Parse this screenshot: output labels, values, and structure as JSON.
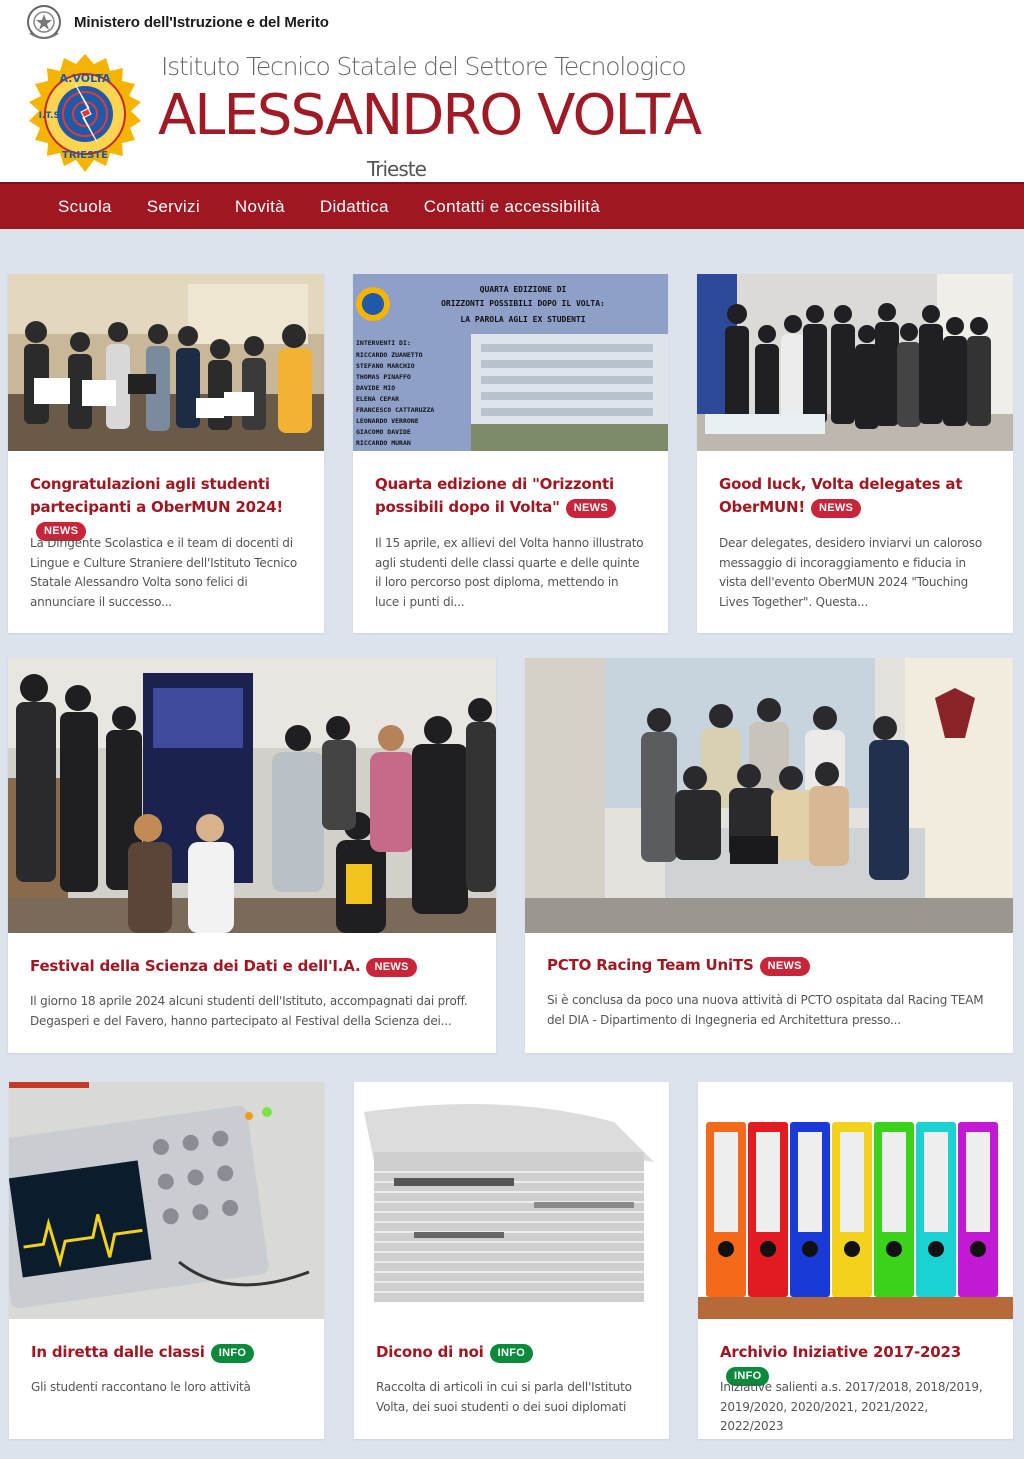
{
  "header": {
    "ministry": "Ministero dell'Istruzione e del Merito",
    "school_subtitle": "Istituto Tecnico Statale del Settore Tecnologico",
    "school_name": "ALESSANDRO VOLTA",
    "school_city": "Trieste"
  },
  "nav": {
    "items": [
      "Scuola",
      "Servizi",
      "Novità",
      "Didattica",
      "Contatti e accessibilità"
    ]
  },
  "cards": [
    {
      "title": "Congratulazioni agli studenti partecipanti a OberMUN 2024!",
      "badge": "NEWS",
      "text": "La Dirigente Scolastica e il team di docenti di Lingue e Culture Straniere dell'Istituto Tecnico Statale Alessandro Volta sono felici di annunciare il successo..."
    },
    {
      "title": "Quarta edizione di \"Orizzonti possibili dopo il Volta\"",
      "badge": "NEWS",
      "text": "Il 15 aprile, ex allievi del Volta hanno illustrato agli studenti delle classi quarte e delle quinte il loro percorso post diploma, mettendo in luce i punti di...",
      "poster": {
        "heading": [
          "QUARTA EDIZIONE DI",
          "ORIZZONTI POSSIBILI DOPO IL VOLTA:",
          "LA PAROLA AGLI EX STUDENTI"
        ],
        "speakers_label": "INTERVENTI DI:",
        "speakers": [
          "RICCARDO ZUANETTO",
          "STEFANO MARCHIO",
          "THOMAS PINAFFO",
          "DAVIDE MIO",
          "ELENA CEPAR",
          "FRANCESCO CATTARUZZA",
          "LEONARDO VERRONE",
          "GIACOMO DAVIDE",
          "RICCARDO MURAN"
        ]
      }
    },
    {
      "title": "Good luck, Volta delegates at OberMUN!",
      "badge": "NEWS",
      "text": "Dear delegates, desidero inviarvi un caloroso messaggio di incoraggiamento e fiducia in vista dell'evento OberMUN 2024 \"Touching Lives Together\". Questa..."
    },
    {
      "title": "Festival della Scienza dei Dati e dell'I.A.",
      "badge": "NEWS",
      "text": "Il giorno 18 aprile 2024 alcuni studenti dell'Istituto, accompagnati dai proff. Degasperi e del Favero, hanno partecipato al Festival della Scienza dei..."
    },
    {
      "title": "PCTO Racing Team UniTS",
      "badge": "NEWS",
      "text": "Si è conclusa da poco una nuova attività di PCTO ospitata dal Racing TEAM del DIA - Dipartimento di Ingegneria ed Architettura presso..."
    },
    {
      "title": "In diretta dalle classi",
      "badge": "INFO",
      "text": "Gli studenti raccontano le loro attività"
    },
    {
      "title": "Dicono di noi",
      "badge": "INFO",
      "text": "Raccolta di articoli in cui si parla dell'Istituto Volta, dei suoi studenti o dei suoi diplomati"
    },
    {
      "title": "Archivio Iniziative 2017-2023",
      "badge": "INFO",
      "text": "Iniziative salienti a.s. 2017/2018, 2018/2019, 2019/2020, 2020/2021, 2021/2022, 2022/2023"
    }
  ],
  "colors": {
    "brand_red": "#a01722",
    "news_badge": "#c8243a",
    "info_badge": "#0c8a3c",
    "page_bg": "#dde3ec"
  }
}
